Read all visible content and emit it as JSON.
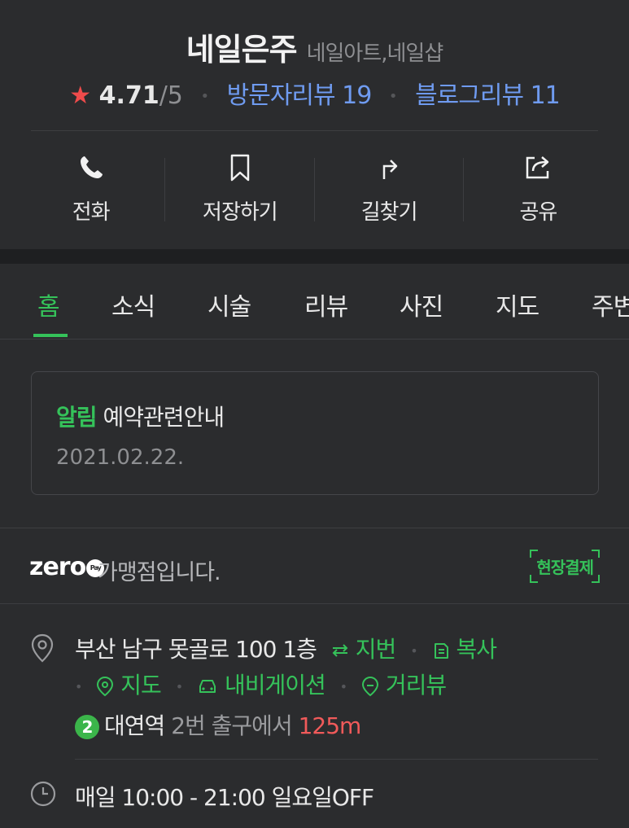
{
  "place": {
    "name": "네일은주",
    "category": "네일아트,네일샵",
    "rating": "4.71",
    "rating_max": "/5",
    "visitor_reviews": "방문자리뷰 19",
    "blog_reviews": "블로그리뷰 11"
  },
  "actions": [
    {
      "label": "전화",
      "icon": "phone-icon"
    },
    {
      "label": "저장하기",
      "icon": "bookmark-icon"
    },
    {
      "label": "길찾기",
      "icon": "directions-icon"
    },
    {
      "label": "공유",
      "icon": "share-icon"
    }
  ],
  "tabs": [
    "홈",
    "소식",
    "시술",
    "리뷰",
    "사진",
    "지도",
    "주변"
  ],
  "active_tab": "홈",
  "notice": {
    "tag": "알림",
    "title": "예약관련안내",
    "date": "2021.02.22."
  },
  "zeropay": {
    "logo": "zero",
    "pay_badge": "Pay",
    "text": "가맹점입니다.",
    "badge": "현장결제"
  },
  "address": {
    "text": "부산 남구 못골로 100 1층",
    "jibeon": "지번",
    "copy": "복사",
    "map": "지도",
    "navigation": "내비게이션",
    "street_view": "거리뷰"
  },
  "subway": {
    "line": "2",
    "station": "대연역",
    "exit": "2번 출구에서",
    "distance": "125m"
  },
  "hours": {
    "text": "매일 10:00 - 21:00 일요일OFF"
  },
  "colors": {
    "background": "#2b2c2e",
    "accent_green": "#35c25a",
    "link_blue": "#6f9bf0",
    "star_red": "#f04b4b",
    "distance_red": "#f05a5a",
    "subway_line2": "#3bb54a"
  }
}
